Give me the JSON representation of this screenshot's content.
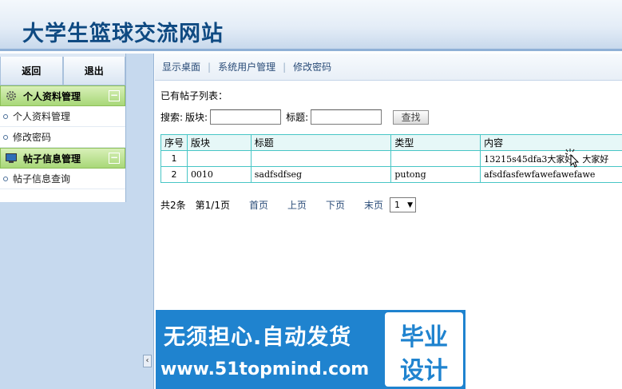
{
  "header": {
    "title": "大学生篮球交流网站"
  },
  "sidebar": {
    "back_label": "返回",
    "logout_label": "退出",
    "sections": [
      {
        "title": "个人资料管理",
        "collapse": "−",
        "items": [
          "个人资料管理",
          "修改密码"
        ]
      },
      {
        "title": "帖子信息管理",
        "collapse": "−",
        "items": [
          "帖子信息查询"
        ]
      }
    ],
    "collapse_handle": "‹"
  },
  "nav": {
    "items": [
      "显示桌面",
      "系统用户管理",
      "修改密码"
    ],
    "separator": "|"
  },
  "main": {
    "list_title": "已有帖子列表：",
    "search": {
      "label": "搜索:",
      "board_label": "版块:",
      "title_label": "标题:",
      "board_value": "",
      "title_value": "",
      "button": "查找"
    }
  },
  "table": {
    "headers": [
      "序号",
      "版块",
      "标题",
      "类型",
      "内容"
    ],
    "rows": [
      [
        "1",
        "",
        "",
        "",
        "13215s45dfa3大家好，大家好"
      ],
      [
        "2",
        "0010",
        "sadfsdfseg",
        "putong",
        "afsdfasfewfawefawefawe"
      ]
    ]
  },
  "pager": {
    "total": "共2条",
    "page": "第1/1页",
    "first": "首页",
    "prev": "上页",
    "next": "下页",
    "last": "末页",
    "selected": "1",
    "arrow": "▼"
  },
  "ad": {
    "line1": "无须担心.自动发货",
    "line2": "www.51topmind.com",
    "stamp_line1": "毕业",
    "stamp_line2": "设计"
  },
  "colors": {
    "title": "#0f4a82",
    "sidebar_bg": "#c6d9ee",
    "section_green": "#a8d878",
    "table_border": "#48c6c6",
    "table_header_bg": "#e6f7f7",
    "ad_blue": "#1f83cf"
  }
}
